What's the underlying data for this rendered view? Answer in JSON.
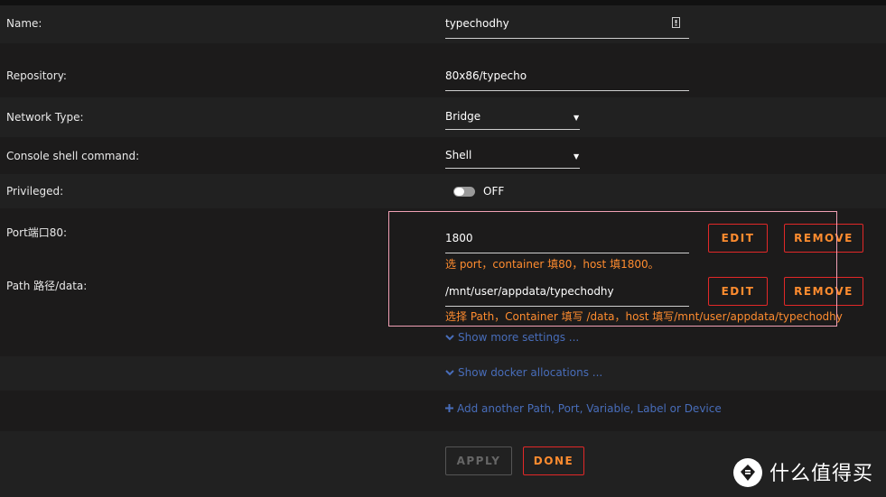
{
  "form": {
    "name": {
      "label": "Name:",
      "value": "typechodhy"
    },
    "repository": {
      "label": "Repository:",
      "value": "80x86/typecho"
    },
    "network_type": {
      "label": "Network Type:",
      "value": "Bridge"
    },
    "console_shell": {
      "label": "Console shell command:",
      "value": "Shell"
    },
    "privileged": {
      "label": "Privileged:",
      "state": "OFF"
    },
    "port": {
      "label": "Port端口80:",
      "value": "1800",
      "hint": "选 port，container 填80，host 填1800。",
      "edit_label": "EDIT",
      "remove_label": "REMOVE"
    },
    "path": {
      "label": "Path 路径/data:",
      "value": "/mnt/user/appdata/typechodhy",
      "hint": "选择 Path，Container 填写 /data，host 填写/mnt/user/appdata/typechodhy",
      "edit_label": "EDIT",
      "remove_label": "REMOVE"
    }
  },
  "links": {
    "show_more": "Show more settings ...",
    "show_docker": "Show docker allocations ...",
    "add_another": "Add another Path, Port, Variable, Label or Device"
  },
  "actions": {
    "apply_label": "APPLY",
    "done_label": "DONE"
  },
  "watermark": {
    "text": "什么值得买"
  },
  "colors": {
    "background": "#1c1b1b",
    "row_alt": "#212121",
    "accent_orange": "#ff8c2f",
    "button_border": "#e22828",
    "link_blue": "#486dba",
    "highlight_pink": "#f0a0b4"
  },
  "icons": {
    "name_field": "doc-icon",
    "dropdown": "caret-down-icon",
    "expand": "chevron-down-icon",
    "add": "plus-icon",
    "watermark": "smzdm-logo-icon"
  }
}
